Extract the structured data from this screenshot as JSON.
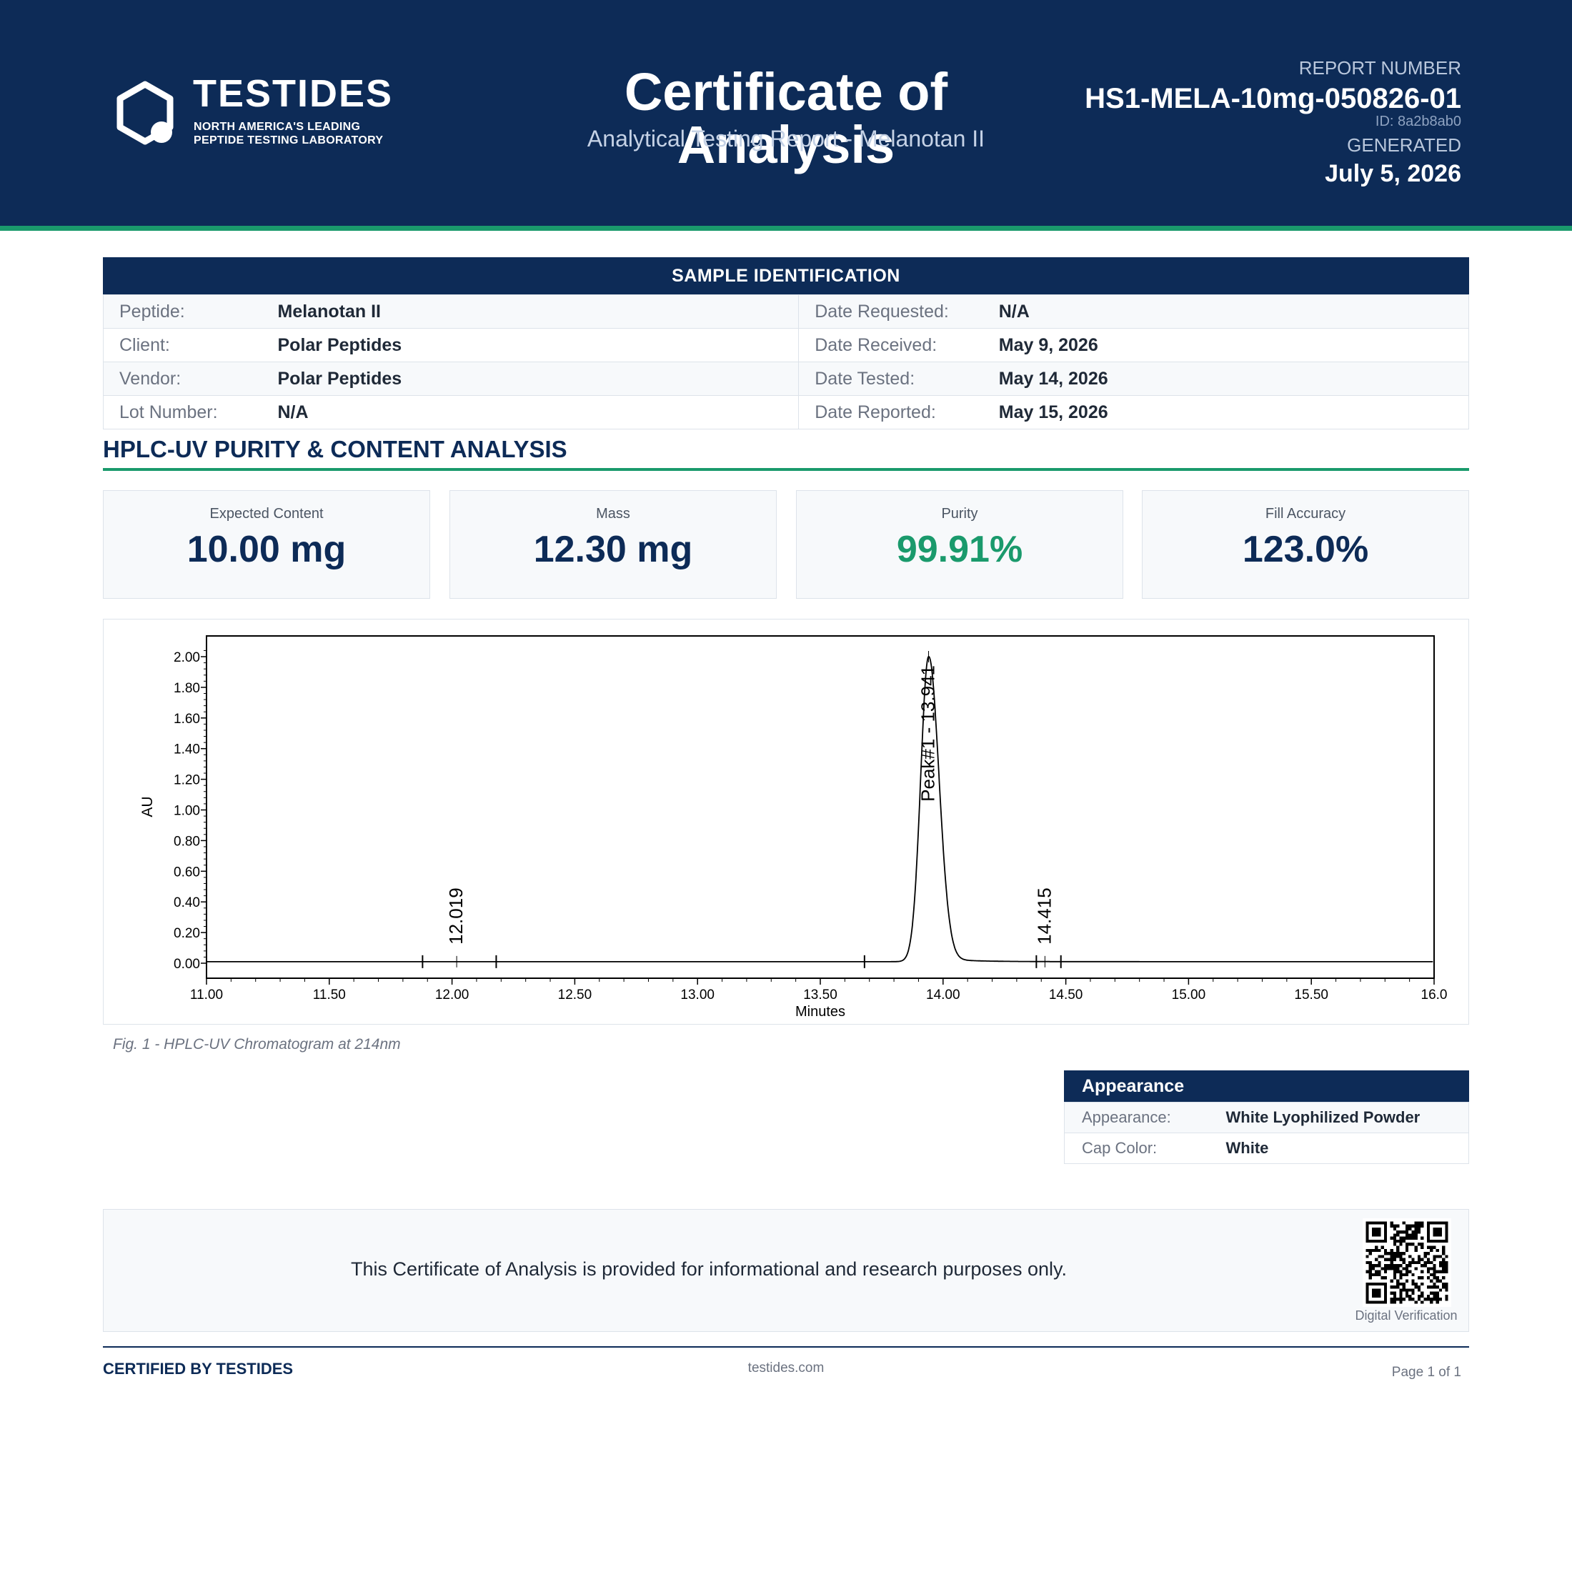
{
  "header": {
    "brand": "TESTIDES",
    "tagline_line1": "NORTH AMERICA'S LEADING",
    "tagline_line2": "PEPTIDE TESTING LABORATORY",
    "title": "Certificate of Analysis",
    "subtitle": "Analytical Testing Report  -  Melanotan II",
    "report_number_label": "REPORT NUMBER",
    "report_number": "HS1-MELA-10mg-050826-01",
    "report_id": "ID: 8a2b8ab0",
    "generated_label": "GENERATED",
    "generated_date": "July 5, 2026"
  },
  "sample": {
    "heading": "SAMPLE IDENTIFICATION",
    "rows": [
      {
        "label1": "Peptide:",
        "value1": "Melanotan II",
        "label2": "Date Requested:",
        "value2": "N/A"
      },
      {
        "label1": "Client:",
        "value1": "Polar Peptides",
        "label2": "Date Received:",
        "value2": "May 9, 2026"
      },
      {
        "label1": "Vendor:",
        "value1": "Polar Peptides",
        "label2": "Date Tested:",
        "value2": "May 14, 2026"
      },
      {
        "label1": "Lot Number:",
        "value1": "N/A",
        "label2": "Date Reported:",
        "value2": "May 15, 2026"
      }
    ]
  },
  "analysis": {
    "title": "HPLC-UV PURITY & CONTENT ANALYSIS",
    "metrics": [
      {
        "label": "Expected Content",
        "value": "10.00 mg"
      },
      {
        "label": "Mass",
        "value": "12.30 mg"
      },
      {
        "label": "Purity",
        "value": "99.91%"
      },
      {
        "label": "Fill Accuracy",
        "value": "123.0%"
      }
    ],
    "figure_caption": "Fig. 1  -  HPLC-UV Chromatogram at 214nm"
  },
  "chart_data": {
    "type": "line",
    "title": "",
    "xlabel": "Minutes",
    "ylabel": "AU",
    "xlim": [
      11.0,
      16.0
    ],
    "ylim": [
      0.0,
      2.1
    ],
    "x_ticks": [
      "11.00",
      "11.50",
      "12.00",
      "12.50",
      "13.00",
      "13.50",
      "14.00",
      "14.50",
      "15.00",
      "15.50",
      "16.0"
    ],
    "y_ticks": [
      "0.00",
      "0.20",
      "0.40",
      "0.60",
      "0.80",
      "1.00",
      "1.20",
      "1.40",
      "1.60",
      "1.80",
      "2.00"
    ],
    "grid": false,
    "baseline_au": 0.01,
    "peaks": [
      {
        "label": "12.019",
        "rt": 12.019,
        "height": 0.01,
        "start": 11.88,
        "end": 12.18
      },
      {
        "label": "Peak#1 - 13.941",
        "rt": 13.941,
        "height": 2.0,
        "start": 13.68,
        "end": null
      },
      {
        "label": "14.415",
        "rt": 14.415,
        "height": 0.01,
        "start": 14.38,
        "end": 14.48
      }
    ]
  },
  "appearance": {
    "heading": "Appearance",
    "rows": [
      {
        "label": "Appearance:",
        "value": "White Lyophilized Powder"
      },
      {
        "label": "Cap Color:",
        "value": "White"
      }
    ]
  },
  "disclaimer": {
    "text": "This Certificate of Analysis is provided for informational and research purposes only.",
    "qr_label": "Digital Verification"
  },
  "footer": {
    "certified": "CERTIFIED BY TESTIDES",
    "website": "testides.com",
    "page": "Page 1 of 1"
  },
  "colors": {
    "navy": "#0d2b57",
    "green": "#1a9a6c"
  },
  "icons": {
    "logo": "hexagon-logo-icon",
    "qr": "qr-code-icon"
  }
}
